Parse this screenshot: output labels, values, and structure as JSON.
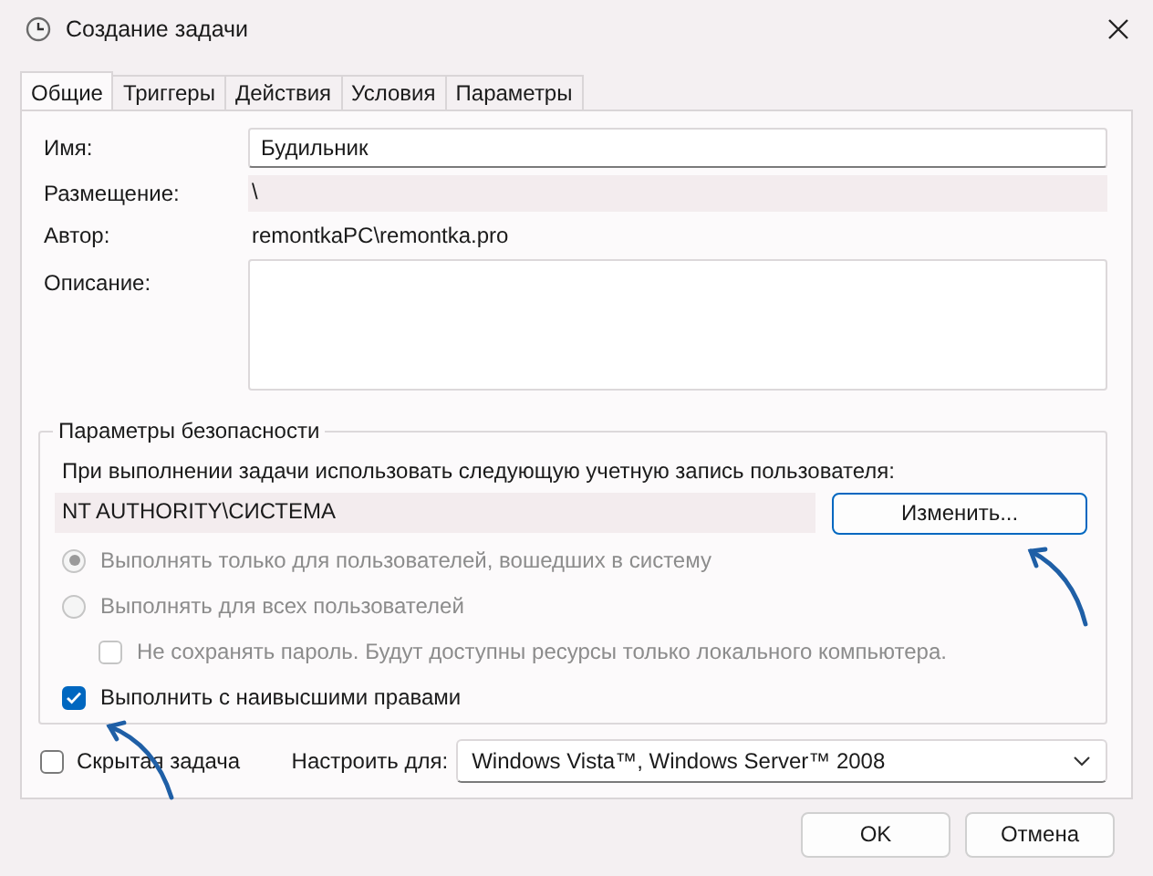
{
  "window": {
    "title": "Создание задачи"
  },
  "tabs": [
    {
      "label": "Общие",
      "selected": true
    },
    {
      "label": "Триггеры",
      "selected": false
    },
    {
      "label": "Действия",
      "selected": false
    },
    {
      "label": "Условия",
      "selected": false
    },
    {
      "label": "Параметры",
      "selected": false
    }
  ],
  "fields": [
    {
      "kind": "input",
      "label": "Имя:",
      "value": "Будильник"
    },
    {
      "kind": "readonly",
      "label": "Размещение:",
      "value": "\\"
    },
    {
      "kind": "text",
      "label": "Автор:",
      "value": "remontkaPC\\remontka.pro"
    },
    {
      "kind": "textarea",
      "label": "Описание:"
    }
  ],
  "security": {
    "title": "Параметры безопасности",
    "prompt": "При выполнении задачи использовать следующую учетную запись пользователя:",
    "account": "NT AUTHORITY\\СИСТЕМА",
    "change_button": "Изменить...",
    "options": [
      {
        "kind": "radio",
        "label": "Выполнять только для пользователей, вошедших в систему",
        "checked": true,
        "disabled": true
      },
      {
        "kind": "radio",
        "label": "Выполнять для всех пользователей",
        "checked": false,
        "disabled": true,
        "children": [
          {
            "kind": "checkbox",
            "label": "Не сохранять пароль. Будут доступны ресурсы только локального компьютера.",
            "checked": false,
            "disabled": true
          }
        ]
      },
      {
        "kind": "checkbox",
        "label": "Выполнить с наивысшими правами",
        "checked": true,
        "disabled": false
      }
    ]
  },
  "hidden_task": {
    "label": "Скрытая задача",
    "checked": false
  },
  "configure_for": {
    "label": "Настроить для:",
    "value": "Windows Vista™, Windows Server™ 2008"
  },
  "buttons": [
    "OK",
    "Отмена"
  ]
}
